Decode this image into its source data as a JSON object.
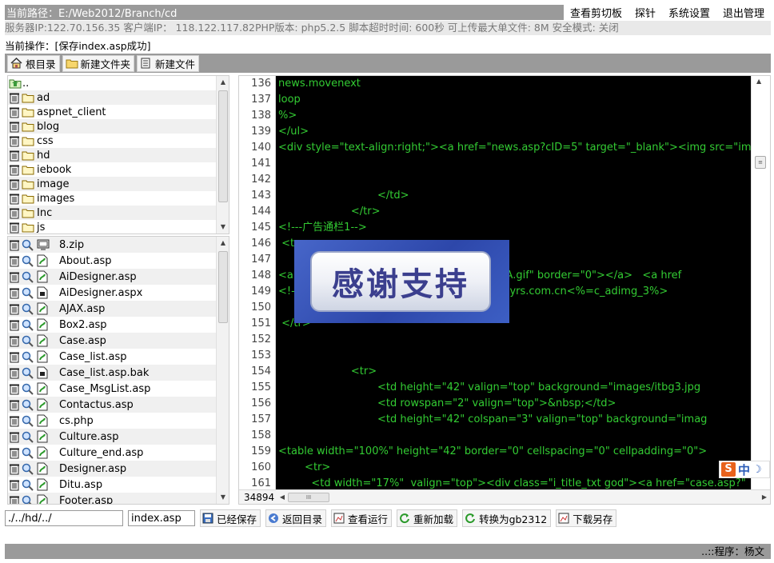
{
  "header": {
    "path_label": "当前路径：E:/Web2012/Branch/cd",
    "menu": [
      "查看剪切板",
      "探针",
      "系统设置",
      "退出管理"
    ]
  },
  "server_info": "服务器IP:122.70.156.35 客户端IP： 118.122.117.82PHP版本: php5.2.5 脚本超时时间: 600秒 可上传最大单文件: 8M 安全模式: 关闭",
  "current_op": "当前操作：[保存index.asp成功]",
  "toolbar": {
    "root_label": "根目录",
    "new_folder_label": "新建文件夹",
    "new_file_label": "新建文件"
  },
  "directories": [
    "..",
    "ad",
    "aspnet_client",
    "blog",
    "css",
    "hd",
    "iebook",
    "image",
    "images",
    "Inc",
    "js"
  ],
  "files": [
    "8.zip",
    "About.asp",
    "AiDesigner.asp",
    "AiDesigner.aspx",
    "AJAX.asp",
    "Box2.asp",
    "Case.asp",
    "Case_list.asp",
    "Case_list.asp.bak",
    "Case_MsgList.asp",
    "Contactus.asp",
    "cs.php",
    "Culture.asp",
    "Culture_end.asp",
    "Designer.asp",
    "Ditu.asp",
    "Footer.asp"
  ],
  "editor": {
    "line_numbers": [
      "136",
      "137",
      "138",
      "139",
      "140",
      "141",
      "142",
      "143",
      "144",
      "145",
      "146",
      "147",
      "148",
      "149",
      "150",
      "151",
      "152",
      "153",
      "154",
      "155",
      "156",
      "157",
      "158",
      "159",
      "160",
      "161"
    ],
    "lines": [
      "news.movenext",
      "loop",
      "%>",
      "</ul>",
      "<div style=\"text-align:right;\"><a href=\"news.asp?cID=5\" target=\"_blank\"><img src=\"images",
      "",
      "",
      "                              </td>",
      "                      </tr>",
      "<!---广告通栏1-->",
      " <tr>",
      "",
      "<a                                         <img src=\"hd/A.gif\" border=\"0\"></a>   <a href",
      "<!-                                        \"http://branch.dyrs.com.cn<%=c_adimg_3%>",
      "",
      " </tr>",
      "",
      "",
      "                      <tr>",
      "                              <td height=\"42\" valign=\"top\" background=\"images/itbg3.jpg",
      "                              <td rowspan=\"2\" valign=\"top\">&nbsp;</td>",
      "                              <td height=\"42\" colspan=\"3\" valign=\"top\" background=\"imag",
      "",
      "<table width=\"100%\" height=\"42\" border=\"0\" cellspacing=\"0\" cellpadding=\"0\">",
      "        <tr>",
      "          <td width=\"17%\"  valign=\"top\"><div class=\"i_title_txt god\"><a href=\"case.asp?\""
    ],
    "total_lines": "34894",
    "hscroll_thumb": "III",
    "text_color": "#33cc33",
    "bg_color": "#000000"
  },
  "overlay_text": "感谢支持",
  "ime": {
    "logo": "S",
    "mode": "中",
    "moon": "☽"
  },
  "bottom": {
    "path_value": "./../hd/../",
    "filename_value": "index.asp",
    "buttons": [
      "已经保存",
      "返回目录",
      "查看运行",
      "重新加载",
      "转换为gb2312",
      "下载另存"
    ]
  },
  "footer": "..::程序：杨文"
}
